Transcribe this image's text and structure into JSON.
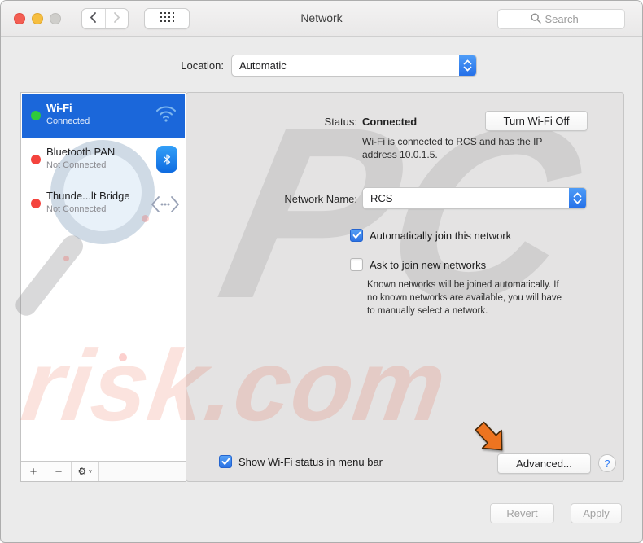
{
  "window": {
    "title": "Network"
  },
  "titlebar": {
    "search_placeholder": "Search"
  },
  "location_bar": {
    "label": "Location:",
    "value": "Automatic"
  },
  "sidebar": {
    "items": [
      {
        "name": "Wi-Fi",
        "status": "Connected",
        "icon": "wifi-icon",
        "dot_color": "#2fcb3d",
        "selected": true
      },
      {
        "name": "Bluetooth PAN",
        "status": "Not Connected",
        "icon": "bluetooth-icon",
        "dot_color": "#f4433d",
        "selected": false
      },
      {
        "name": "Thunde...lt Bridge",
        "status": "Not Connected",
        "icon": "thunderbolt-bridge-icon",
        "dot_color": "#f4433d",
        "selected": false
      }
    ],
    "footer": {
      "add_label": "+",
      "remove_label": "−",
      "gear_label": "⚙",
      "gear_chevron": "∨"
    }
  },
  "main": {
    "status": {
      "label": "Status:",
      "value": "Connected",
      "button": "Turn Wi-Fi Off",
      "description_line1": "Wi-Fi is connected to RCS and has the IP",
      "description_line2": "address 10.0.1.5."
    },
    "network_name": {
      "label": "Network Name:",
      "value": "RCS"
    },
    "auto_join": {
      "label": "Automatically join this network",
      "checked": true
    },
    "ask_join": {
      "label": "Ask to join new networks",
      "checked": false,
      "help_line1": "Known networks will be joined automatically. If",
      "help_line2": "no known networks are available, you will have",
      "help_line3": "to manually select a network."
    },
    "menu_bar": {
      "label": "Show Wi-Fi status in menu bar",
      "checked": true
    },
    "advanced_button": "Advanced...",
    "help_button": "?"
  },
  "action_bar": {
    "revert_button": "Revert",
    "apply_button": "Apply",
    "enabled": false
  },
  "watermarks": {
    "brand_text": "risk.com",
    "logo_text": "PC"
  },
  "icons": {
    "back": "chevron-left",
    "forward": "chevron-right",
    "grid": "show-all-grid",
    "search": "magnifier",
    "wifi": "wifi-waves",
    "bluetooth": "bluetooth-rune",
    "thunderbolt_bridge": "angle-brackets-dots",
    "stepper": "up-down-chevrons",
    "check": "checkmark",
    "pointer": "orange-arrow"
  },
  "colors": {
    "selection_blue": "#1b67da",
    "accent_blue": "#2b72e4",
    "status_green": "#2fcb3d",
    "status_red": "#f4433d",
    "arrow_orange": "#ed7420",
    "help_blue": "#2f7cf6",
    "watermark_red": "#e94e34"
  }
}
